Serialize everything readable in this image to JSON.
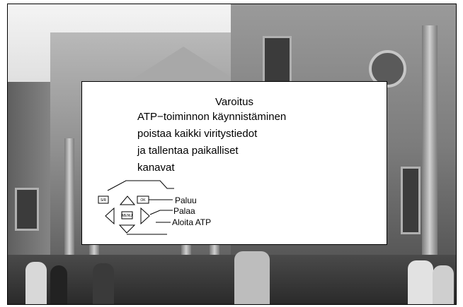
{
  "dialog": {
    "title": "Varoitus",
    "message_lines": [
      "ATP−toiminnon käynnistäminen",
      "poistaa kaikki viritystiedot",
      "ja tallentaa paikalliset",
      "kanavat"
    ]
  },
  "keys": {
    "menu_label": "MENU",
    "source_label": "S/R",
    "ok_label": "OK",
    "back_action": "Paluu",
    "return_action": "Palaa",
    "start_action": "Aloita ATP"
  }
}
